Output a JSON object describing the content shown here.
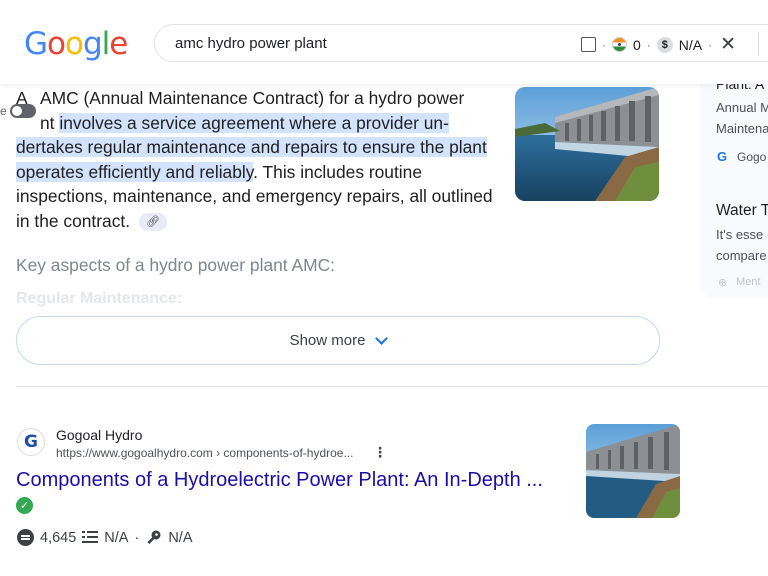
{
  "header": {
    "logo": [
      "G",
      "o",
      "o",
      "g",
      "l",
      "e"
    ],
    "logo_colors": [
      "#4285f4",
      "#ea4335",
      "#fbbc05",
      "#4285f4",
      "#34a853",
      "#ea4335"
    ],
    "search_query": "amc hydro power plant",
    "ext_count": "0",
    "ext_value": "N/A",
    "dot": "·",
    "close_glyph": "✕"
  },
  "ai_overview": {
    "lead_glyph": "A",
    "line1": "AMC (Annual Maintenance Contract) for a hydro power",
    "line2_pre": "nt ",
    "highlight": "involves a service agreement where a provider un-dertakes regular maintenance and repairs to ensure the plant operates efficiently and reliably",
    "rest": ". This includes routine inspections, maintenance, and emergency repairs, all outlined in the contract.",
    "key_aspects": "Key aspects of a hydro power plant AMC:",
    "faded_heading": "Regular Maintenance:",
    "show_more": "Show more"
  },
  "side_panel": {
    "item1_title": "Plant: A",
    "item1_line1": "Annual M",
    "item1_line2": "Maintena",
    "item1_source": "Gogo",
    "item2_title": "Water T",
    "item2_line1": "It's esse",
    "item2_line2": "compare",
    "item2_source": "Ment"
  },
  "result": {
    "favicon": "G",
    "site_name": "Gogoal Hydro",
    "url": "https://www.gogoalhydro.com › components-of-hydroe...",
    "title": "Components of a Hydroelectric Power Plant: An In-Depth ...",
    "comments": "4,645",
    "words": "N/A",
    "keywords": "N/A",
    "dot": "·",
    "kebab": "⋮"
  },
  "colors": {
    "highlight": "#d3e3fd",
    "link": "#1a0dab",
    "verified": "#34a853"
  }
}
